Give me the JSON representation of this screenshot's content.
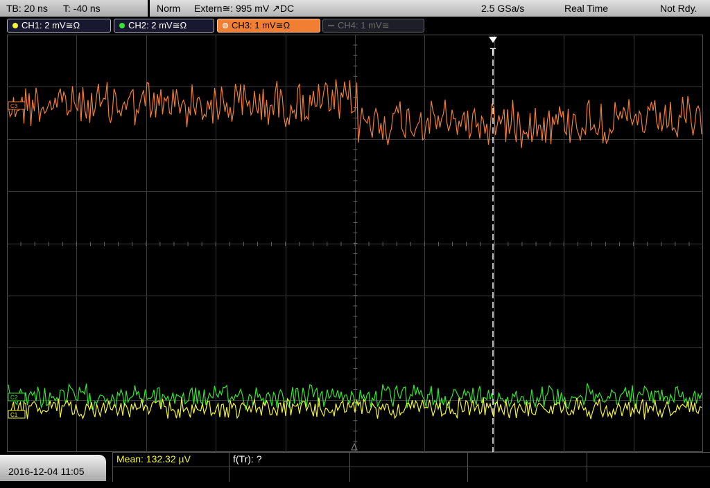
{
  "status_bar": {
    "timebase": "TB: 20 ns",
    "trigger_time": "T: -40 ns",
    "mode": "Norm",
    "trigger_source": "Extern≅: 995 mV ↗DC",
    "sample_rate": "2.5 GSa/s",
    "acq_mode": "Real Time",
    "status": "Not Rdy."
  },
  "channels": [
    {
      "label": "CH1: 2 mV≅Ω",
      "color": "#f5f53a",
      "active": true
    },
    {
      "label": "CH2: 2 mV≅Ω",
      "color": "#32e632",
      "active": true
    },
    {
      "label": "CH3: 1 mV≅Ω",
      "color": "#f07f34",
      "active": true
    },
    {
      "label": "CH4: 1 mV≅",
      "color": "#6a6a6a",
      "active": false
    }
  ],
  "trace_markers": {
    "ch3": "C3",
    "ch2": "C2",
    "ch1": "C1",
    "trigger": "T"
  },
  "colors": {
    "ch1": "#f5f53a",
    "ch2": "#32e632",
    "ch3": "#f07f34",
    "grid": "#3a3a3a",
    "trigger_line": "#ffffff"
  },
  "bottom_bar": {
    "datetime": "2016-12-04 11:05",
    "measurement_1": "Mean: 132.32 µV",
    "measurement_2": "f(Tr): ?"
  }
}
